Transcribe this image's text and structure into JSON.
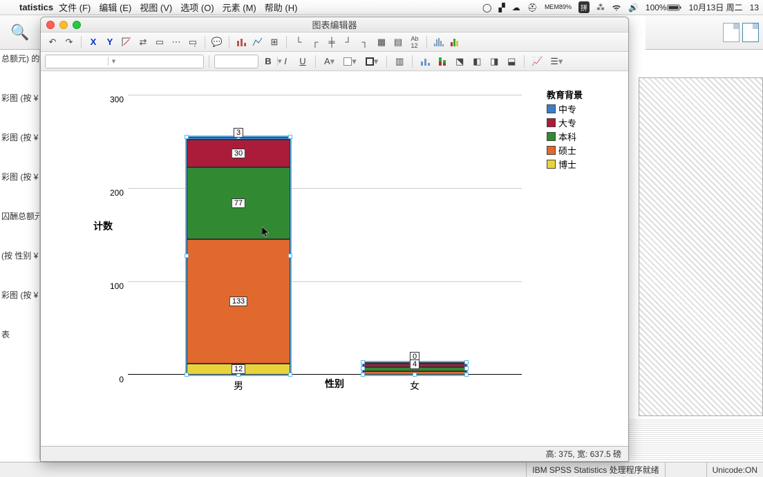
{
  "menubar": {
    "app": "tatistics",
    "items": [
      "文件 (F)",
      "编辑 (E)",
      "视图 (V)",
      "选项 (O)",
      "元素 (M)",
      "帮助 (H)"
    ],
    "mem_label": "MEM",
    "mem_pct": "89%",
    "battery": "100%",
    "date": "10月13日 周二",
    "time_frag": "13"
  },
  "outline": {
    "items": [
      "总额元) 的",
      "彩图 (按 ¥",
      "彩图 (按 ¥",
      "彩图 (按 ¥",
      "囚酬总额元",
      "(按 性别 ¥",
      "彩图 (按 ¥",
      "表"
    ]
  },
  "editor": {
    "title": "图表编辑器",
    "font_sample": "A",
    "status": "高:  375,  宽:   637.5 磅"
  },
  "statusbar": {
    "center": "IBM SPSS Statistics 处理程序就绪",
    "right": "Unicode:ON"
  },
  "chart_data": {
    "type": "bar",
    "stacked": true,
    "xlabel": "性别",
    "ylabel": "计数",
    "ylim": [
      0,
      300
    ],
    "yticks": [
      0,
      100,
      200,
      300
    ],
    "categories": [
      "男",
      "女"
    ],
    "legend_title": "教育背景",
    "series": [
      {
        "name": "中专",
        "color": "#3b7ec9",
        "values": [
          3,
          1
        ]
      },
      {
        "name": "大专",
        "color": "#aa1c3a",
        "values": [
          30,
          4
        ]
      },
      {
        "name": "本科",
        "color": "#318a32",
        "values": [
          77,
          4
        ]
      },
      {
        "name": "硕士",
        "color": "#e1692e",
        "values": [
          133,
          4
        ]
      },
      {
        "name": "博士",
        "color": "#e8d43a",
        "values": [
          12,
          0
        ]
      }
    ],
    "visible_labels": {
      "男": [
        "3",
        "30",
        "77",
        "133",
        "12"
      ],
      "女": [
        "4",
        "0"
      ]
    }
  }
}
